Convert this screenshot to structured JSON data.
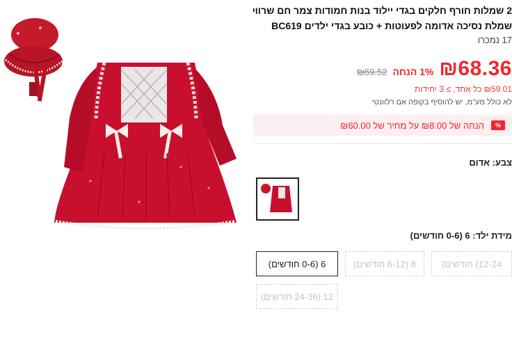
{
  "product": {
    "title_line1": "2 שמלות חורף חלקים בגדי יילוד בנות חמודות צמר חם שרוול ארוך",
    "title_line2": "שמלת נסיכה אדומה לפעוטות + כובע בגדי ילדים BC619",
    "sold": "17 נמכרו"
  },
  "pricing": {
    "price": "₪68.36",
    "discount": "1% הנחה",
    "old_price": "₪69.52",
    "bulk": "₪59.01 כל אחד, ≥ 3 יחידות",
    "tax_note": "לא כולל מע\"מ, יש להוסיף בקופה אם רלוונטי"
  },
  "coupon": {
    "badge": "%",
    "text": "הנחה של ₪8.00 על מחיר של ₪60.00"
  },
  "color": {
    "label": "צבע: אדום",
    "selected": "אדום"
  },
  "size": {
    "label": "מידת ילד: 6 (0-6 חודשים)",
    "options": [
      {
        "label": "6 (0-6 חודשים)",
        "state": "selected"
      },
      {
        "label": "8 (6-12 חודשים)",
        "state": "disabled"
      },
      {
        "label": "12-24) חודשים)",
        "state": "disabled"
      },
      {
        "label": "12 (24-36 חודשים)",
        "state": "disabled"
      }
    ]
  },
  "colors": {
    "price_red": "#f0262d",
    "dress_red": "#c8102e",
    "coupon_bg": "#fdeef0"
  }
}
